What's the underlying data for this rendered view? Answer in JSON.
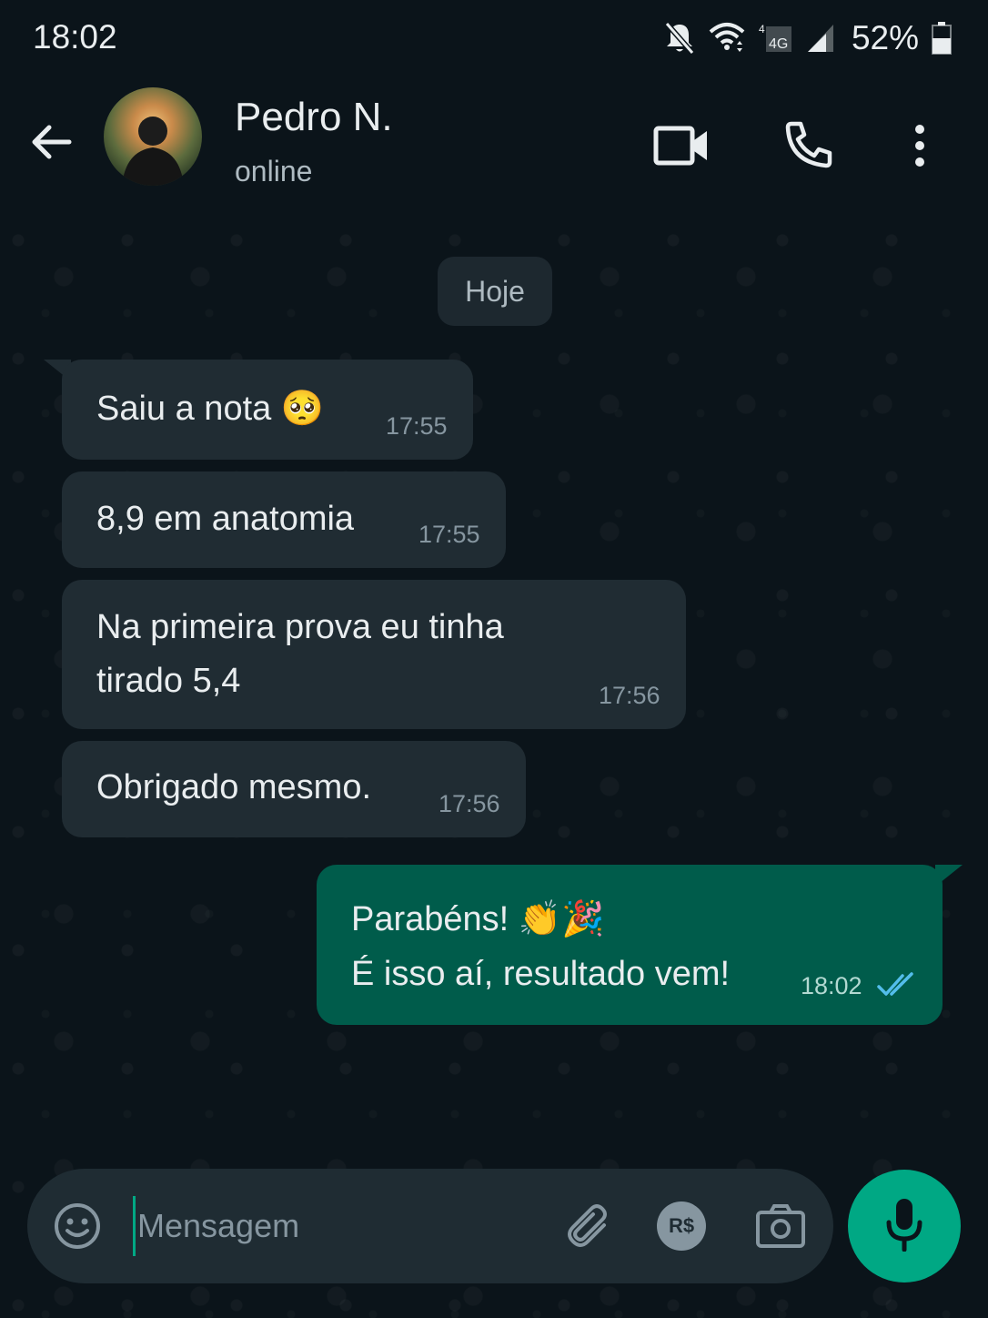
{
  "status_bar": {
    "time": "18:02",
    "network": "4G",
    "battery": "52%",
    "icons": [
      "notifications-off-icon",
      "wifi-icon",
      "mobile-data-icon",
      "signal-icon",
      "battery-icon"
    ]
  },
  "header": {
    "contact_name": "Pedro N.",
    "contact_status": "online",
    "icons": [
      "back-arrow-icon",
      "video-call-icon",
      "voice-call-icon",
      "more-options-icon"
    ]
  },
  "chat": {
    "date_chip": "Hoje",
    "messages": [
      {
        "direction": "in",
        "lines": [
          "Saiu a nota 🥺"
        ],
        "time": "17:55"
      },
      {
        "direction": "in",
        "lines": [
          "8,9 em anatomia"
        ],
        "time": "17:55"
      },
      {
        "direction": "in",
        "lines": [
          "Na primeira prova eu tinha",
          "tirado 5,4"
        ],
        "time": "17:56"
      },
      {
        "direction": "in",
        "lines": [
          "Obrigado mesmo."
        ],
        "time": "17:56"
      },
      {
        "direction": "out",
        "lines": [
          "Parabéns! 👏🎉",
          "É isso aí, resultado vem!"
        ],
        "time": "18:02",
        "read_status": "read"
      }
    ]
  },
  "composer": {
    "placeholder": "Mensagem",
    "value": "",
    "payment_label": "R$",
    "icons": [
      "emoji-icon",
      "attach-icon",
      "payment-icon",
      "camera-icon",
      "mic-icon"
    ]
  },
  "colors": {
    "background": "#0b141a",
    "incoming_bubble": "#202c33",
    "outgoing_bubble": "#005c4b",
    "accent": "#00a884",
    "read_ticks": "#53bdeb"
  }
}
